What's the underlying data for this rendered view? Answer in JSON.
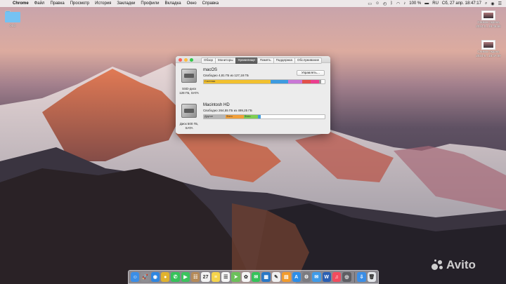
{
  "menubar": {
    "apple_icon": "apple-logo-icon",
    "app_name": "Chrome",
    "items": [
      "Файл",
      "Правка",
      "Просмотр",
      "История",
      "Закладки",
      "Профили",
      "Вкладка",
      "Окно",
      "Справка"
    ],
    "status": {
      "battery": "100 %",
      "lang": "RU",
      "datetime": "Сб, 27 апр.  18:47:17"
    }
  },
  "desktop": {
    "folder_label": "OLD",
    "screenshots": [
      {
        "line1": "Снимок экрана",
        "line2": "2024-0...18.46.56"
      },
      {
        "line1": "Снимок экрана",
        "line2": "2024-0...18.47.09"
      }
    ]
  },
  "window": {
    "tabs": [
      {
        "label": "Обзор",
        "active": false
      },
      {
        "label": "Мониторы",
        "active": false
      },
      {
        "label": "Хранилище",
        "active": true
      },
      {
        "label": "Память",
        "active": false
      },
      {
        "label": "Поддержка",
        "active": false
      },
      {
        "label": "Обслуживание",
        "active": false
      }
    ],
    "volumes": [
      {
        "name": "macOS",
        "free": "Свободно 4,81 ГБ из 127,18 ГБ",
        "caption1": "SSD-диск",
        "caption2": "128 ГБ, SATA",
        "manage_label": "Управлять…",
        "segments": [
          {
            "label": "Система",
            "fraction": 0.555,
            "color": "#f2c12e"
          },
          {
            "label": "",
            "fraction": 0.14,
            "color": "#3d9be0"
          },
          {
            "label": "",
            "fraction": 0.12,
            "color": "#c977d6"
          },
          {
            "label": "",
            "fraction": 0.07,
            "color": "#e2504a"
          },
          {
            "label": "",
            "fraction": 0.07,
            "color": "#ec3d8f"
          },
          {
            "label": "",
            "fraction": 0.015,
            "color": "#9a9a9a"
          }
        ]
      },
      {
        "name": "Macintosh HD",
        "free": "Свободно 264,55 ГБ из 499,25 ГБ",
        "caption1": "Диск 500 ГБ,",
        "caption2": "SATA",
        "segments": [
          {
            "label": "Другое",
            "fraction": 0.18,
            "color": "#b7b7b7"
          },
          {
            "label": "Фото",
            "fraction": 0.15,
            "color": "#f2a03a"
          },
          {
            "label": "Фото",
            "fraction": 0.12,
            "color": "#7fcf52"
          },
          {
            "label": "",
            "fraction": 0.02,
            "color": "#3d9be0"
          }
        ]
      }
    ]
  },
  "dock": {
    "apps": [
      {
        "name": "finder-icon",
        "color": "#3b8ee6",
        "glyph": "☺"
      },
      {
        "name": "launchpad-icon",
        "color": "#8e8e93",
        "glyph": "🚀"
      },
      {
        "name": "safari-icon",
        "color": "#2f86e0",
        "glyph": "◉"
      },
      {
        "name": "chrome-icon",
        "color": "#e0b22e",
        "glyph": "●"
      },
      {
        "name": "whatsapp-icon",
        "color": "#35c25a",
        "glyph": "✆"
      },
      {
        "name": "facetime-icon",
        "color": "#3cc35e",
        "glyph": "▶"
      },
      {
        "name": "contacts-icon",
        "color": "#b58a58",
        "glyph": "☷"
      },
      {
        "name": "calendar-icon",
        "color": "#f3f3f3",
        "glyph": "27"
      },
      {
        "name": "notes-icon",
        "color": "#f5d44c",
        "glyph": "≡"
      },
      {
        "name": "reminders-icon",
        "color": "#f5f5f5",
        "glyph": "☰"
      },
      {
        "name": "maps-icon",
        "color": "#6cbf5b",
        "glyph": "➤"
      },
      {
        "name": "photos-icon",
        "color": "#f5f5f5",
        "glyph": "✿"
      },
      {
        "name": "messages-icon",
        "color": "#35c25a",
        "glyph": "✉"
      },
      {
        "name": "trello-icon",
        "color": "#2a78c6",
        "glyph": "▦"
      },
      {
        "name": "textedit-icon",
        "color": "#f0f0f0",
        "glyph": "✎"
      },
      {
        "name": "books-icon",
        "color": "#f29b2b",
        "glyph": "▤"
      },
      {
        "name": "appstore-icon",
        "color": "#2d8ee8",
        "glyph": "A"
      },
      {
        "name": "system-preferences-icon",
        "color": "#7b7b80",
        "glyph": "⚙"
      },
      {
        "name": "mail-icon",
        "color": "#3f9be8",
        "glyph": "✉"
      },
      {
        "name": "word-icon",
        "color": "#2a5fb3",
        "glyph": "W"
      },
      {
        "name": "music-icon",
        "color": "#f14c5e",
        "glyph": "♫"
      },
      {
        "name": "disk-utility-icon",
        "color": "#5e5e63",
        "glyph": "◎"
      }
    ],
    "trailing": [
      {
        "name": "downloads-stack-icon",
        "color": "#3b8ee6",
        "glyph": "⇩"
      },
      {
        "name": "trash-icon",
        "color": "#e3e6ea",
        "glyph": "🗑"
      }
    ]
  },
  "watermark": {
    "text": "Avito"
  }
}
